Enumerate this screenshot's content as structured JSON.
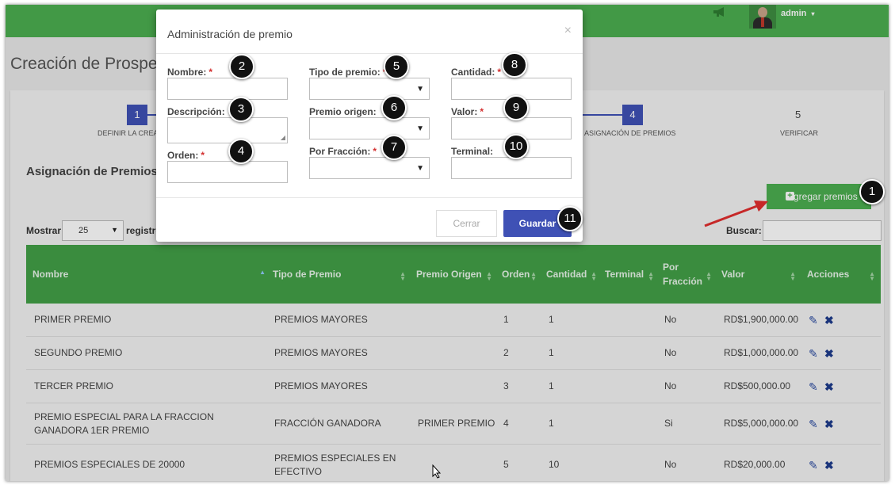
{
  "topbar": {
    "user": "admin",
    "user_caret": "▾",
    "icons": [
      "megaphone-icon",
      "avatar"
    ]
  },
  "page_title": "Creación de Prospec",
  "steps": [
    {
      "num": "1",
      "label": "DEFINIR LA CREAC"
    },
    {
      "num": "4",
      "label": "ASIGNACIÓN DE PREMIOS"
    },
    {
      "num": "5",
      "label": "VERIFICAR"
    }
  ],
  "section_title": "Asignación de Premios",
  "add_button": "Agregar premios",
  "table_controls": {
    "show_label": "Mostrar",
    "page_size": "25",
    "show_after": "registros",
    "search_label": "Buscar:"
  },
  "table": {
    "headers": [
      "Nombre",
      "Tipo de Premio",
      "Premio Origen",
      "Orden",
      "Cantidad",
      "Terminal",
      "Por\nFracción",
      "Valor",
      "Acciones"
    ],
    "rows": [
      {
        "nombre": "PRIMER PREMIO",
        "tipo": "PREMIOS MAYORES",
        "origen": "",
        "orden": "1",
        "cantidad": "1",
        "terminal": "",
        "fraccion": "No",
        "valor": "RD$1,900,000.00"
      },
      {
        "nombre": "SEGUNDO PREMIO",
        "tipo": "PREMIOS MAYORES",
        "origen": "",
        "orden": "2",
        "cantidad": "1",
        "terminal": "",
        "fraccion": "No",
        "valor": "RD$1,000,000.00"
      },
      {
        "nombre": "TERCER PREMIO",
        "tipo": "PREMIOS MAYORES",
        "origen": "",
        "orden": "3",
        "cantidad": "1",
        "terminal": "",
        "fraccion": "No",
        "valor": "RD$500,000.00"
      },
      {
        "nombre": "PREMIO ESPECIAL PARA LA FRACCION GANADORA 1ER PREMIO",
        "tipo": "FRACCIÓN GANADORA",
        "origen": "PRIMER PREMIO",
        "orden": "4",
        "cantidad": "1",
        "terminal": "",
        "fraccion": "Si",
        "valor": "RD$5,000,000.00"
      },
      {
        "nombre": "PREMIOS ESPECIALES DE 20000",
        "tipo": "PREMIOS ESPECIALES EN EFECTIVO",
        "origen": "",
        "orden": "5",
        "cantidad": "10",
        "terminal": "",
        "fraccion": "No",
        "valor": "RD$20,000.00"
      }
    ]
  },
  "modal": {
    "title": "Administración de premio",
    "close": "×",
    "fields": {
      "nombre": "Nombre:",
      "descripcion": "Descripción:",
      "orden": "Orden:",
      "tipo_premio": "Tipo de premio:",
      "premio_origen": "Premio origen:",
      "por_fraccion": "Por Fracción:",
      "cantidad": "Cantidad:",
      "valor": "Valor:",
      "terminal": "Terminal:"
    },
    "required_mark": "*",
    "cancel": "Cerrar",
    "save": "Guardar"
  },
  "callouts": [
    "1",
    "2",
    "3",
    "4",
    "5",
    "6",
    "7",
    "8",
    "9",
    "10",
    "11"
  ],
  "colors": {
    "green": "#4caf50",
    "header_green": "#43a047",
    "blue": "#3f51b5",
    "arrow_red": "#c62828"
  }
}
